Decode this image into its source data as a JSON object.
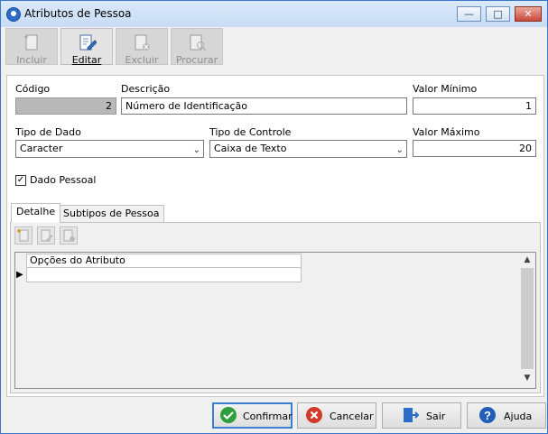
{
  "window": {
    "title": "Atributos de Pessoa",
    "minimize_glyph": "—",
    "maximize_glyph": "□",
    "close_glyph": "✕",
    "icon": "app-icon"
  },
  "toolbar": {
    "incluir": {
      "label": "Incluir",
      "icon": "add-document-icon",
      "enabled": false
    },
    "editar": {
      "label": "Editar",
      "icon": "edit-document-icon",
      "enabled": true
    },
    "excluir": {
      "label": "Excluir",
      "icon": "delete-document-icon",
      "enabled": false
    },
    "procurar": {
      "label": "Procurar",
      "icon": "search-document-icon",
      "enabled": false
    }
  },
  "form": {
    "codigo": {
      "label": "Código",
      "value": "2"
    },
    "descricao": {
      "label": "Descrição",
      "value": "Número de Identificação"
    },
    "valor_minimo": {
      "label": "Valor Mínimo",
      "value": "1"
    },
    "tipo_dado": {
      "label": "Tipo de Dado",
      "value": "Caracter"
    },
    "tipo_controle": {
      "label": "Tipo de Controle",
      "value": "Caixa de Texto"
    },
    "valor_maximo": {
      "label": "Valor Máximo",
      "value": "20"
    },
    "dado_pessoal": {
      "label": "Dado Pessoal",
      "checked": true,
      "check_glyph": "✓"
    }
  },
  "tabs": [
    {
      "label": "Detalhe",
      "active": true
    },
    {
      "label": "Subtipos de Pessoa",
      "active": false
    }
  ],
  "grid": {
    "columns": [
      "Opções do Atributo"
    ],
    "rows": [
      ""
    ],
    "row_indicator": "▶",
    "scroll_up": "▲",
    "scroll_down": "▼"
  },
  "buttons": {
    "confirmar": {
      "label": "Confirmar",
      "icon": "check-icon",
      "color": "#2e9e3e"
    },
    "cancelar": {
      "label": "Cancelar",
      "icon": "cancel-icon",
      "color": "#d23a2a"
    },
    "sair": {
      "label": "Sair",
      "icon": "exit-door-icon",
      "color": "#2b6cc4"
    },
    "ajuda": {
      "label": "Ajuda",
      "icon": "help-icon",
      "color": "#1f5fb5"
    }
  }
}
